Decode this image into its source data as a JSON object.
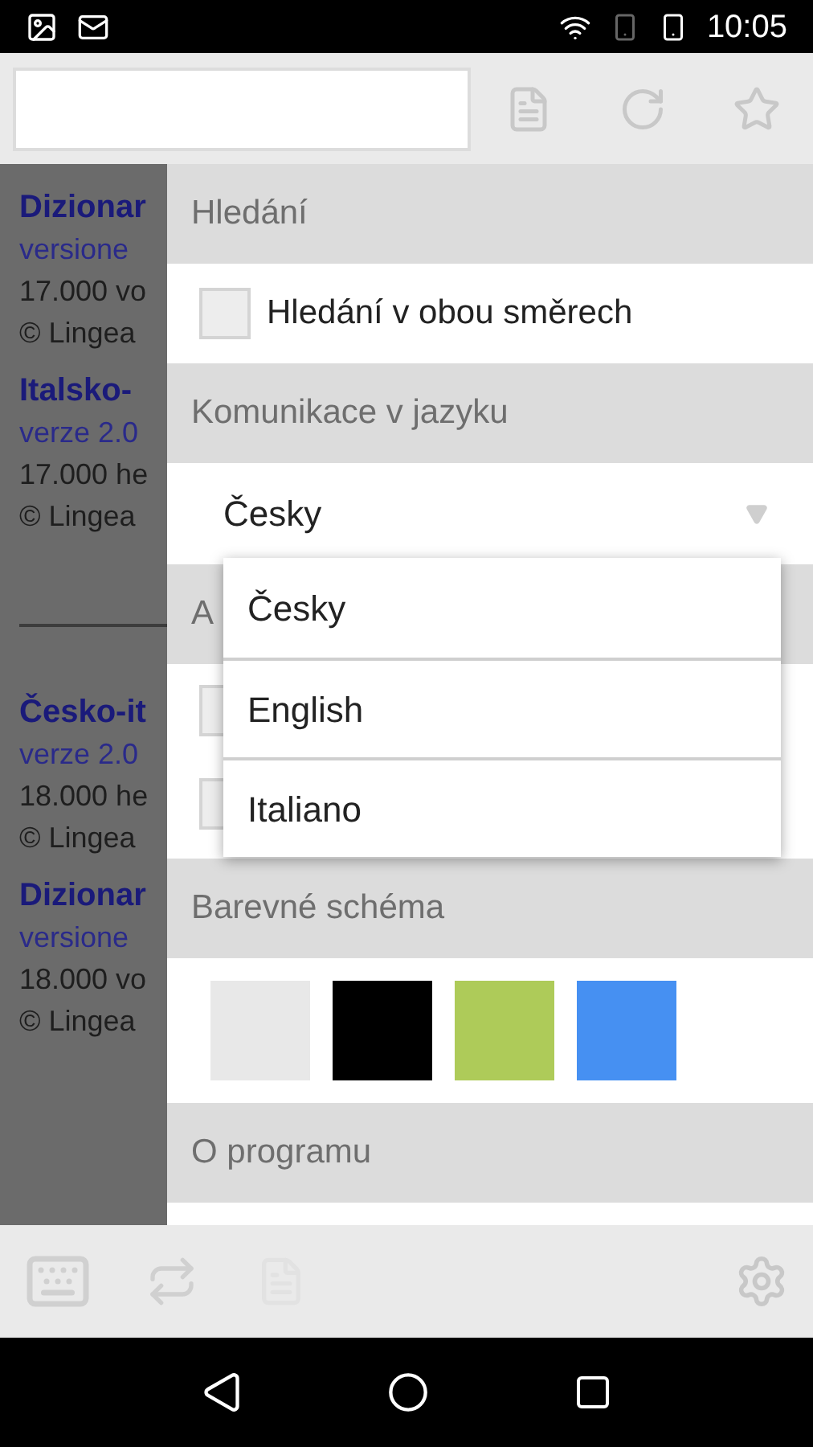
{
  "status_bar": {
    "time": "10:05"
  },
  "search": {
    "kind": "empty"
  },
  "dictionaries": [
    {
      "title": "Dizionar",
      "version": "versione",
      "count": "17.000 vo",
      "copyright": "© Lingea"
    },
    {
      "title": "Italsko-",
      "version": "verze 2.0",
      "count": "17.000 he",
      "copyright": "© Lingea"
    },
    {
      "title": "Česko-it",
      "version": "verze 2.0",
      "count": "18.000 he",
      "copyright": "© Lingea",
      "divider_before": true
    },
    {
      "title": "Dizionar",
      "version": "versione",
      "count": "18.000 vo",
      "copyright": "© Lingea"
    }
  ],
  "settings": {
    "search_header": "Hledání",
    "search_options": [
      {
        "label": "Hledání v obou směrech",
        "checked": false
      }
    ],
    "language_header": "Komunikace v jazyku",
    "language_value": "Česky",
    "hidden_header": "A",
    "hidden_options": [
      {
        "checked": false
      },
      {
        "checked": false
      }
    ],
    "color_header": "Barevné schéma",
    "color_schemes": [
      {
        "color": "#e8e8e8"
      },
      {
        "color": "#000000"
      },
      {
        "color": "#aecb59"
      },
      {
        "color": "#4690f2"
      }
    ],
    "about_header": "O programu"
  },
  "language_menu": [
    {
      "label": "Česky"
    },
    {
      "label": "English"
    },
    {
      "label": "Italiano"
    }
  ]
}
